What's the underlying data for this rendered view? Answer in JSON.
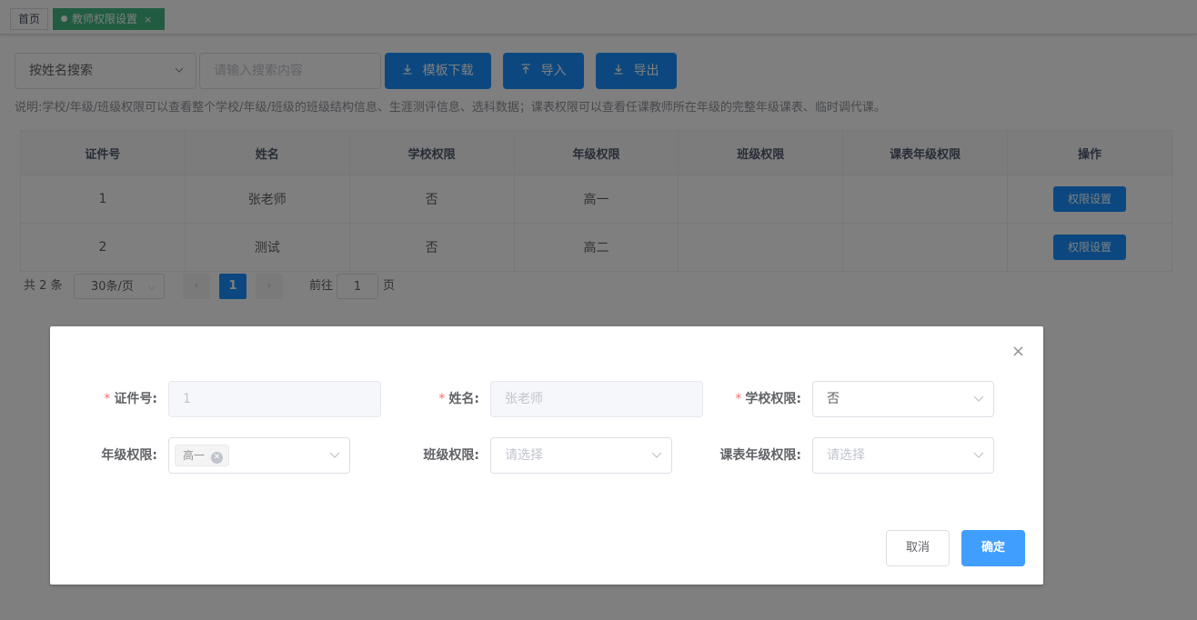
{
  "tabs": {
    "home": "首页",
    "active": "教师权限设置",
    "close": "×"
  },
  "toolbar": {
    "search_type": "按姓名搜索",
    "search_placeholder": "请输入搜索内容",
    "download_label": "模板下载",
    "import_label": "导入",
    "export_label": "导出"
  },
  "note": "说明:学校/年级/班级权限可以查看整个学校/年级/班级的班级结构信息、生涯测评信息、选科数据；课表权限可以查看任课教师所在年级的完整年级课表、临时调代课。",
  "table": {
    "headers": [
      "证件号",
      "姓名",
      "学校权限",
      "年级权限",
      "班级权限",
      "课表年级权限",
      "操作"
    ],
    "rows": [
      {
        "id": "1",
        "name": "张老师",
        "school": "否",
        "grade": "高一",
        "class": "",
        "schedule": "",
        "action": "权限设置"
      },
      {
        "id": "2",
        "name": "测试",
        "school": "否",
        "grade": "高二",
        "class": "",
        "schedule": "",
        "action": "权限设置"
      }
    ]
  },
  "pagination": {
    "total": "共 2 条",
    "page_size": "30条/页",
    "current_page": "1",
    "goto_label": "前往",
    "goto_value": "1",
    "page_unit": "页"
  },
  "dialog": {
    "close": "×",
    "required_mark": "*",
    "id_label": "证件号:",
    "id_value": "1",
    "name_label": "姓名:",
    "name_value": "张老师",
    "school_label": "学校权限:",
    "school_value": "否",
    "grade_label": "年级权限:",
    "grade_tag": "高一",
    "class_label": "班级权限:",
    "class_placeholder": "请选择",
    "schedule_label": "课表年级权限:",
    "schedule_placeholder": "请选择",
    "cancel_label": "取消",
    "ok_label": "确定"
  },
  "colors": {
    "primary": "#1890ff",
    "active_tab": "#42b983",
    "ok_button": "#409eff",
    "required": "#f56c6c"
  },
  "icons": [
    "download-icon",
    "upload-icon",
    "chevron-down-icon",
    "close-icon"
  ]
}
